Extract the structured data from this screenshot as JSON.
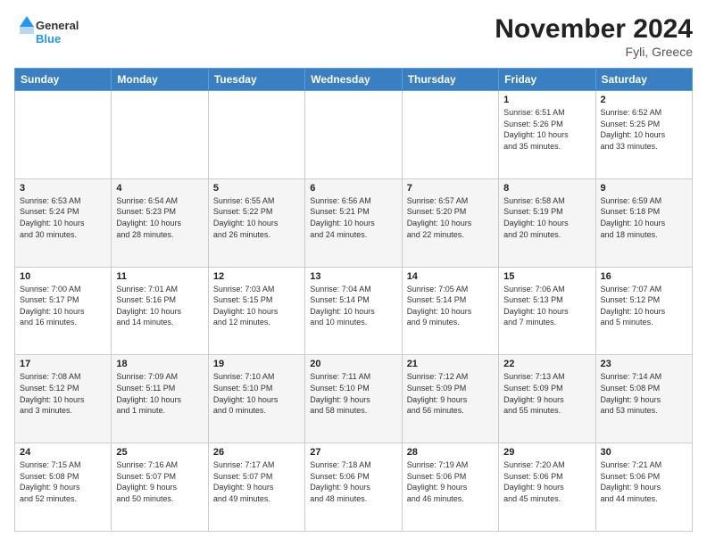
{
  "logo": {
    "line1": "General",
    "line2": "Blue"
  },
  "title": "November 2024",
  "subtitle": "Fyli, Greece",
  "days_header": [
    "Sunday",
    "Monday",
    "Tuesday",
    "Wednesday",
    "Thursday",
    "Friday",
    "Saturday"
  ],
  "weeks": [
    [
      {
        "day": "",
        "info": ""
      },
      {
        "day": "",
        "info": ""
      },
      {
        "day": "",
        "info": ""
      },
      {
        "day": "",
        "info": ""
      },
      {
        "day": "",
        "info": ""
      },
      {
        "day": "1",
        "info": "Sunrise: 6:51 AM\nSunset: 5:26 PM\nDaylight: 10 hours\nand 35 minutes."
      },
      {
        "day": "2",
        "info": "Sunrise: 6:52 AM\nSunset: 5:25 PM\nDaylight: 10 hours\nand 33 minutes."
      }
    ],
    [
      {
        "day": "3",
        "info": "Sunrise: 6:53 AM\nSunset: 5:24 PM\nDaylight: 10 hours\nand 30 minutes."
      },
      {
        "day": "4",
        "info": "Sunrise: 6:54 AM\nSunset: 5:23 PM\nDaylight: 10 hours\nand 28 minutes."
      },
      {
        "day": "5",
        "info": "Sunrise: 6:55 AM\nSunset: 5:22 PM\nDaylight: 10 hours\nand 26 minutes."
      },
      {
        "day": "6",
        "info": "Sunrise: 6:56 AM\nSunset: 5:21 PM\nDaylight: 10 hours\nand 24 minutes."
      },
      {
        "day": "7",
        "info": "Sunrise: 6:57 AM\nSunset: 5:20 PM\nDaylight: 10 hours\nand 22 minutes."
      },
      {
        "day": "8",
        "info": "Sunrise: 6:58 AM\nSunset: 5:19 PM\nDaylight: 10 hours\nand 20 minutes."
      },
      {
        "day": "9",
        "info": "Sunrise: 6:59 AM\nSunset: 5:18 PM\nDaylight: 10 hours\nand 18 minutes."
      }
    ],
    [
      {
        "day": "10",
        "info": "Sunrise: 7:00 AM\nSunset: 5:17 PM\nDaylight: 10 hours\nand 16 minutes."
      },
      {
        "day": "11",
        "info": "Sunrise: 7:01 AM\nSunset: 5:16 PM\nDaylight: 10 hours\nand 14 minutes."
      },
      {
        "day": "12",
        "info": "Sunrise: 7:03 AM\nSunset: 5:15 PM\nDaylight: 10 hours\nand 12 minutes."
      },
      {
        "day": "13",
        "info": "Sunrise: 7:04 AM\nSunset: 5:14 PM\nDaylight: 10 hours\nand 10 minutes."
      },
      {
        "day": "14",
        "info": "Sunrise: 7:05 AM\nSunset: 5:14 PM\nDaylight: 10 hours\nand 9 minutes."
      },
      {
        "day": "15",
        "info": "Sunrise: 7:06 AM\nSunset: 5:13 PM\nDaylight: 10 hours\nand 7 minutes."
      },
      {
        "day": "16",
        "info": "Sunrise: 7:07 AM\nSunset: 5:12 PM\nDaylight: 10 hours\nand 5 minutes."
      }
    ],
    [
      {
        "day": "17",
        "info": "Sunrise: 7:08 AM\nSunset: 5:12 PM\nDaylight: 10 hours\nand 3 minutes."
      },
      {
        "day": "18",
        "info": "Sunrise: 7:09 AM\nSunset: 5:11 PM\nDaylight: 10 hours\nand 1 minute."
      },
      {
        "day": "19",
        "info": "Sunrise: 7:10 AM\nSunset: 5:10 PM\nDaylight: 10 hours\nand 0 minutes."
      },
      {
        "day": "20",
        "info": "Sunrise: 7:11 AM\nSunset: 5:10 PM\nDaylight: 9 hours\nand 58 minutes."
      },
      {
        "day": "21",
        "info": "Sunrise: 7:12 AM\nSunset: 5:09 PM\nDaylight: 9 hours\nand 56 minutes."
      },
      {
        "day": "22",
        "info": "Sunrise: 7:13 AM\nSunset: 5:09 PM\nDaylight: 9 hours\nand 55 minutes."
      },
      {
        "day": "23",
        "info": "Sunrise: 7:14 AM\nSunset: 5:08 PM\nDaylight: 9 hours\nand 53 minutes."
      }
    ],
    [
      {
        "day": "24",
        "info": "Sunrise: 7:15 AM\nSunset: 5:08 PM\nDaylight: 9 hours\nand 52 minutes."
      },
      {
        "day": "25",
        "info": "Sunrise: 7:16 AM\nSunset: 5:07 PM\nDaylight: 9 hours\nand 50 minutes."
      },
      {
        "day": "26",
        "info": "Sunrise: 7:17 AM\nSunset: 5:07 PM\nDaylight: 9 hours\nand 49 minutes."
      },
      {
        "day": "27",
        "info": "Sunrise: 7:18 AM\nSunset: 5:06 PM\nDaylight: 9 hours\nand 48 minutes."
      },
      {
        "day": "28",
        "info": "Sunrise: 7:19 AM\nSunset: 5:06 PM\nDaylight: 9 hours\nand 46 minutes."
      },
      {
        "day": "29",
        "info": "Sunrise: 7:20 AM\nSunset: 5:06 PM\nDaylight: 9 hours\nand 45 minutes."
      },
      {
        "day": "30",
        "info": "Sunrise: 7:21 AM\nSunset: 5:06 PM\nDaylight: 9 hours\nand 44 minutes."
      }
    ]
  ]
}
